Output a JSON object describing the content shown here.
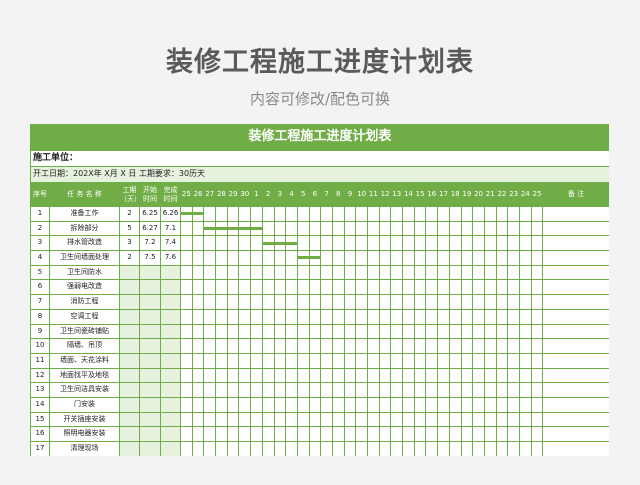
{
  "page": {
    "title": "装修工程施工进度计划表",
    "subtitle": "内容可修改/配色可换"
  },
  "sheet": {
    "title": "装修工程施工进度计划表",
    "unit_label": "施工单位：",
    "date_line": "开工日期：202X年 X月  X  日     工期要求：30历天",
    "headers": {
      "seq": "序号",
      "task": "任 务 名 称",
      "duration": "工期\n（天）",
      "start": "开始\n时间",
      "end": "完成\n时间",
      "remark": "备    注"
    },
    "days": [
      "25",
      "26",
      "27",
      "28",
      "29",
      "30",
      "1",
      "2",
      "3",
      "4",
      "5",
      "6",
      "7",
      "8",
      "9",
      "10",
      "11",
      "12",
      "13",
      "14",
      "15",
      "16",
      "17",
      "18",
      "19",
      "20",
      "21",
      "22",
      "23",
      "24",
      "25"
    ],
    "accent_color": "#70ad47",
    "shade_color": "#e6f2dd",
    "rows": [
      {
        "seq": "1",
        "task": "准备工作",
        "duration": "2",
        "start": "6.25",
        "end": "6.26",
        "bar": [
          0,
          1
        ]
      },
      {
        "seq": "2",
        "task": "拆除部分",
        "duration": "5",
        "start": "6.27",
        "end": "7.1",
        "bar": [
          2,
          6
        ]
      },
      {
        "seq": "3",
        "task": "排水管改造",
        "duration": "3",
        "start": "7.2",
        "end": "7.4",
        "bar": [
          7,
          9
        ]
      },
      {
        "seq": "4",
        "task": "卫生间墙面处理",
        "duration": "2",
        "start": "7.5",
        "end": "7.6",
        "bar": [
          10,
          11
        ]
      },
      {
        "seq": "5",
        "task": "卫生间防水",
        "duration": "",
        "start": "",
        "end": "",
        "bar": null
      },
      {
        "seq": "6",
        "task": "强弱电改造",
        "duration": "",
        "start": "",
        "end": "",
        "bar": null
      },
      {
        "seq": "7",
        "task": "消防工程",
        "duration": "",
        "start": "",
        "end": "",
        "bar": null
      },
      {
        "seq": "8",
        "task": "空调工程",
        "duration": "",
        "start": "",
        "end": "",
        "bar": null
      },
      {
        "seq": "9",
        "task": "卫生间瓷砖铺贴",
        "duration": "",
        "start": "",
        "end": "",
        "bar": null
      },
      {
        "seq": "10",
        "task": "隔墙、吊顶",
        "duration": "",
        "start": "",
        "end": "",
        "bar": null
      },
      {
        "seq": "11",
        "task": "墙面、天花涂料",
        "duration": "",
        "start": "",
        "end": "",
        "bar": null
      },
      {
        "seq": "12",
        "task": "地面找平及地毯",
        "duration": "",
        "start": "",
        "end": "",
        "bar": null
      },
      {
        "seq": "13",
        "task": "卫生间洁具安装",
        "duration": "",
        "start": "",
        "end": "",
        "bar": null
      },
      {
        "seq": "14",
        "task": "门安装",
        "duration": "",
        "start": "",
        "end": "",
        "bar": null
      },
      {
        "seq": "15",
        "task": "开关插座安装",
        "duration": "",
        "start": "",
        "end": "",
        "bar": null
      },
      {
        "seq": "16",
        "task": "照明电器安装",
        "duration": "",
        "start": "",
        "end": "",
        "bar": null
      },
      {
        "seq": "17",
        "task": "清理现场",
        "duration": "",
        "start": "",
        "end": "",
        "bar": null
      }
    ]
  }
}
